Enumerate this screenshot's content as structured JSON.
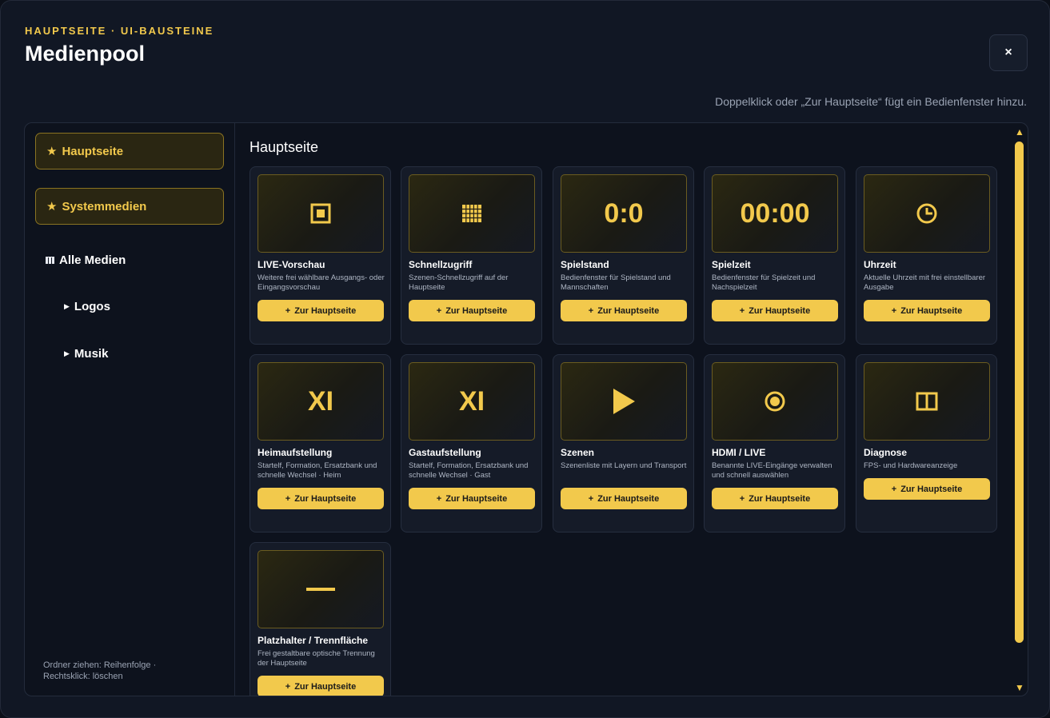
{
  "header": {
    "eyebrow": "HAUPTSEITE · UI-BAUSTEINE",
    "title": "Medienpool",
    "close_label": "×"
  },
  "hint": "Doppelklick oder „Zur Hauptseite“ fügt ein Bedienfenster hinzu.",
  "sidebar": {
    "favorites": [
      "Hauptseite",
      "Systemmedien"
    ],
    "tree": {
      "root": "Alle Medien",
      "children": [
        "Logos",
        "Musik"
      ]
    },
    "footer": "Ordner ziehen: Reihenfolge · Rechtsklick: löschen"
  },
  "main": {
    "section_title": "Hauptseite",
    "button_label": "Zur Hauptseite",
    "cards": [
      {
        "title": "LIVE-Vorschau",
        "desc": "Weitere frei wählbare Ausgangs- oder Eingangsvorschau",
        "icon": "live-preview-icon"
      },
      {
        "title": "Schnellzugriff",
        "desc": "Szenen-Schnellzugriff auf der Hauptseite",
        "icon": "grid-icon"
      },
      {
        "title": "Spielstand",
        "desc": "Bedienfenster für Spielstand und Mannschaften",
        "thumb_text": "0:0"
      },
      {
        "title": "Spielzeit",
        "desc": "Bedienfenster für Spielzeit und Nachspielzeit",
        "thumb_text": "00:00"
      },
      {
        "title": "Uhrzeit",
        "desc": "Aktuelle Uhrzeit mit frei einstellbarer Ausgabe",
        "icon": "clock-icon"
      },
      {
        "title": "Heimaufstellung",
        "desc": "Startelf, Formation, Ersatzbank und schnelle Wechsel · Heim",
        "thumb_text": "XI"
      },
      {
        "title": "Gastaufstellung",
        "desc": "Startelf, Formation, Ersatzbank und schnelle Wechsel · Gast",
        "thumb_text": "XI"
      },
      {
        "title": "Szenen",
        "desc": "Szenenliste mit Layern und Transport",
        "icon": "play-icon"
      },
      {
        "title": "HDMI / LIVE",
        "desc": "Benannte LIVE-Eingänge verwalten und schnell auswählen",
        "icon": "record-icon"
      },
      {
        "title": "Diagnose",
        "desc": "FPS- und Hardwareanzeige",
        "icon": "columns-icon"
      },
      {
        "title": "Platzhalter / Trennfläche",
        "desc": "Frei gestaltbare optische Trennung der Hauptseite",
        "icon": "dash-icon"
      }
    ]
  },
  "colors": {
    "accent": "#f2c94c",
    "background": "#111724"
  }
}
